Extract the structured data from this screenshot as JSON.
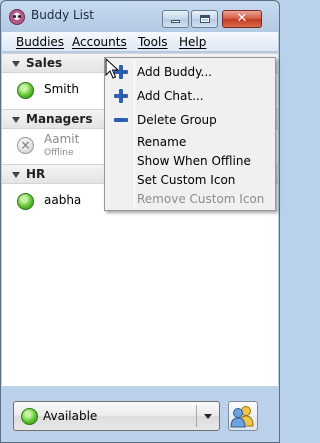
{
  "window": {
    "title": "Buddy List",
    "close_glyph": "✕"
  },
  "menubar": {
    "items": [
      {
        "label": "Buddies"
      },
      {
        "label": "Accounts"
      },
      {
        "label": "Tools"
      },
      {
        "label": "Help"
      }
    ]
  },
  "groups": [
    {
      "name": "Sales",
      "buddies": [
        {
          "name": "Smith",
          "status": "available"
        }
      ]
    },
    {
      "name": "Managers",
      "buddies": [
        {
          "name": "Aamit",
          "sub": "Offline",
          "status": "offline"
        }
      ]
    },
    {
      "name": "HR",
      "buddies": [
        {
          "name": "aabha",
          "status": "available"
        }
      ]
    }
  ],
  "context_menu": {
    "items": [
      {
        "label": "Add Buddy...",
        "icon": "plus-icon",
        "enabled": true
      },
      {
        "label": "Add Chat...",
        "icon": "plus-icon",
        "enabled": true
      },
      {
        "label": "Delete Group",
        "icon": "minus-icon",
        "enabled": true
      },
      {
        "label": "Rename",
        "enabled": true
      },
      {
        "label": "Show When Offline",
        "enabled": true
      },
      {
        "label": "Set Custom Icon",
        "enabled": true
      },
      {
        "label": "Remove Custom Icon",
        "enabled": false
      }
    ]
  },
  "status_selector": {
    "label": "Available",
    "icon": "available-status-icon"
  },
  "colors": {
    "available": "#5ec231",
    "offline": "#c9c9c9",
    "menu_icon": "#2f5fb0",
    "window_frame": "#b9d1ea"
  }
}
